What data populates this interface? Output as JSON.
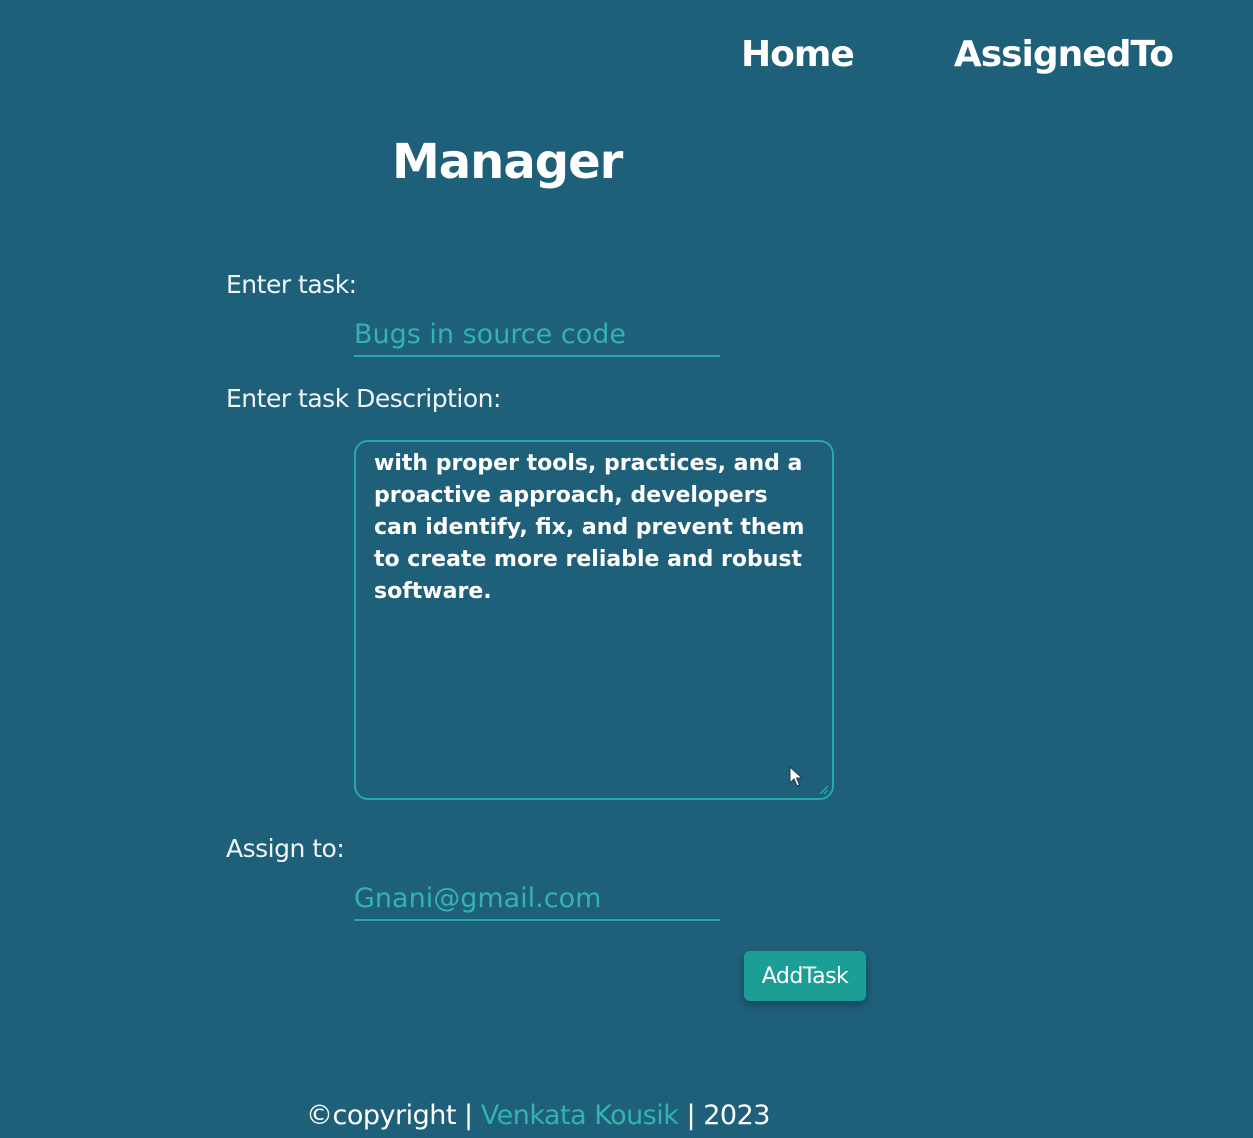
{
  "nav": {
    "home": "Home",
    "assigned_to": "AssignedTo"
  },
  "page_title": "Manager",
  "form": {
    "task_label": "Enter task:",
    "task_value": "Bugs in source code",
    "description_label": "Enter task Description:",
    "description_value": "with proper tools, practices, and a proactive approach, developers can identify, fix, and prevent them to create more reliable and robust software.",
    "assign_label": "Assign to:",
    "assign_value": "Gnani@gmail.com",
    "submit_label": "AddTask"
  },
  "footer": {
    "copyright": "©copyright",
    "separator": "|",
    "author": "Venkata Kousik",
    "year": "2023"
  },
  "colors": {
    "background": "#1e5f7a",
    "accent": "#26a9a6",
    "button": "#1a9e96",
    "text": "#ffffff"
  },
  "icons": {
    "cursor": "mouse-pointer-icon",
    "resize": "resize-handle-icon"
  }
}
